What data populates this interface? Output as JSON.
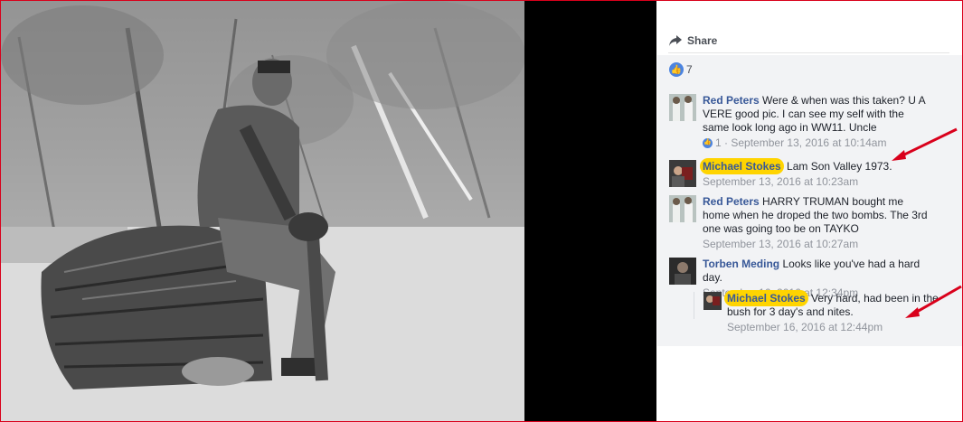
{
  "share": {
    "label": "Share"
  },
  "likes": {
    "count": "7"
  },
  "comments": [
    {
      "author": "Red Peters",
      "text": "Were & when was this taken? U A VERE good pic. I can see my self with the same look long ago in WW11. Uncle",
      "reactions": "1",
      "time": "September 13, 2016 at 10:14am"
    },
    {
      "author": "Michael Stokes",
      "text": "Lam Son Valley 1973.",
      "time": "September 13, 2016 at 10:23am"
    },
    {
      "author": "Red Peters",
      "text": "HARRY TRUMAN bought me home when he droped the two bombs. The 3rd one was going too be on TAYKO",
      "time": "September 13, 2016 at 10:27am"
    },
    {
      "author": "Torben Meding",
      "text": "Looks like you've had a hard day.",
      "time": "September 16, 2016 at 12:34pm"
    }
  ],
  "reply": {
    "author": "Michael Stokes",
    "text": "Very hard, had been in the bush for 3 day's and nites.",
    "time": "September 16, 2016 at 12:44pm"
  },
  "colors": {
    "highlight": "#ffd400",
    "link": "#385898",
    "annotation": "#d9001b"
  },
  "icons": [
    "share-icon",
    "like-icon",
    "annotation-arrow"
  ]
}
